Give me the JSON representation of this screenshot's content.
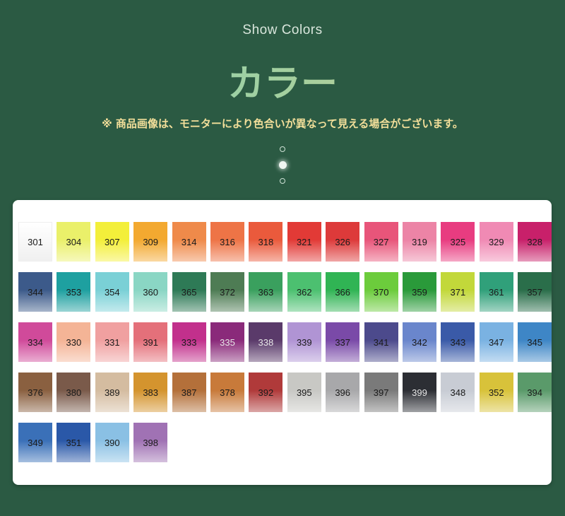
{
  "header": {
    "subtitle": "Show Colors",
    "title": "カラー",
    "notice": "※ 商品画像は、モニターにより色合いが異なって見える場合がございます。"
  },
  "pager": {
    "dots": 3,
    "active_index": 1
  },
  "swatches": [
    [
      {
        "code": "301",
        "color": "#f2f2f2"
      },
      {
        "code": "304",
        "color": "#eaf06a"
      },
      {
        "code": "307",
        "color": "#f3ef3a"
      },
      {
        "code": "309",
        "color": "#f3a930"
      },
      {
        "code": "314",
        "color": "#ef8a4a"
      },
      {
        "code": "316",
        "color": "#ee7446"
      },
      {
        "code": "318",
        "color": "#ea5a3c"
      },
      {
        "code": "321",
        "color": "#e23a36"
      },
      {
        "code": "326",
        "color": "#dd3a3a"
      },
      {
        "code": "327",
        "color": "#e8557a"
      },
      {
        "code": "319",
        "color": "#ec84a6"
      },
      {
        "code": "325",
        "color": "#e83c80"
      },
      {
        "code": "329",
        "color": "#f08ab4"
      },
      {
        "code": "328",
        "color": "#c8206a"
      }
    ],
    [
      {
        "code": "344",
        "color": "#3c5a8a"
      },
      {
        "code": "353",
        "color": "#1ea0a0"
      },
      {
        "code": "354",
        "color": "#7ad0d6"
      },
      {
        "code": "360",
        "color": "#8ad6c4"
      },
      {
        "code": "365",
        "color": "#2e7a56"
      },
      {
        "code": "372",
        "color": "#4e7c54"
      },
      {
        "code": "363",
        "color": "#3aa05e"
      },
      {
        "code": "362",
        "color": "#4cc070"
      },
      {
        "code": "366",
        "color": "#30b454"
      },
      {
        "code": "370",
        "color": "#6ccc3c"
      },
      {
        "code": "359",
        "color": "#2a9a3a"
      },
      {
        "code": "371",
        "color": "#c2d83a"
      },
      {
        "code": "361",
        "color": "#30a07a"
      },
      {
        "code": "357",
        "color": "#2a6e4a"
      }
    ],
    [
      {
        "code": "334",
        "color": "#d04a9a"
      },
      {
        "code": "330",
        "color": "#f4b496"
      },
      {
        "code": "331",
        "color": "#f0a0a0"
      },
      {
        "code": "391",
        "color": "#e4707a"
      },
      {
        "code": "333",
        "color": "#c2308c"
      },
      {
        "code": "335",
        "color": "#8a2a7a"
      },
      {
        "code": "338",
        "color": "#5a3a6a"
      },
      {
        "code": "339",
        "color": "#b094d4"
      },
      {
        "code": "337",
        "color": "#7a4aa8"
      },
      {
        "code": "341",
        "color": "#4c4a8c"
      },
      {
        "code": "342",
        "color": "#6a86cc"
      },
      {
        "code": "343",
        "color": "#3a5aa8"
      },
      {
        "code": "347",
        "color": "#7ab2e2"
      },
      {
        "code": "345",
        "color": "#3e86c6"
      }
    ],
    [
      {
        "code": "376",
        "color": "#8a6040"
      },
      {
        "code": "380",
        "color": "#7a5a4a"
      },
      {
        "code": "389",
        "color": "#d4bca0"
      },
      {
        "code": "383",
        "color": "#d4942e"
      },
      {
        "code": "387",
        "color": "#b4703a"
      },
      {
        "code": "378",
        "color": "#c87a3a"
      },
      {
        "code": "392",
        "color": "#b03a3a"
      },
      {
        "code": "395",
        "color": "#c8c8c4"
      },
      {
        "code": "396",
        "color": "#a8a8aa"
      },
      {
        "code": "397",
        "color": "#7a7a7a"
      },
      {
        "code": "399",
        "color": "#2c2e34"
      },
      {
        "code": "348",
        "color": "#c8ccd4"
      },
      {
        "code": "352",
        "color": "#d8c23a"
      },
      {
        "code": "394",
        "color": "#5a9a6a"
      }
    ],
    [
      {
        "code": "349",
        "color": "#3a70b8"
      },
      {
        "code": "351",
        "color": "#2a58a8"
      },
      {
        "code": "390",
        "color": "#8ac0e4"
      },
      {
        "code": "398",
        "color": "#a072b4"
      }
    ]
  ]
}
